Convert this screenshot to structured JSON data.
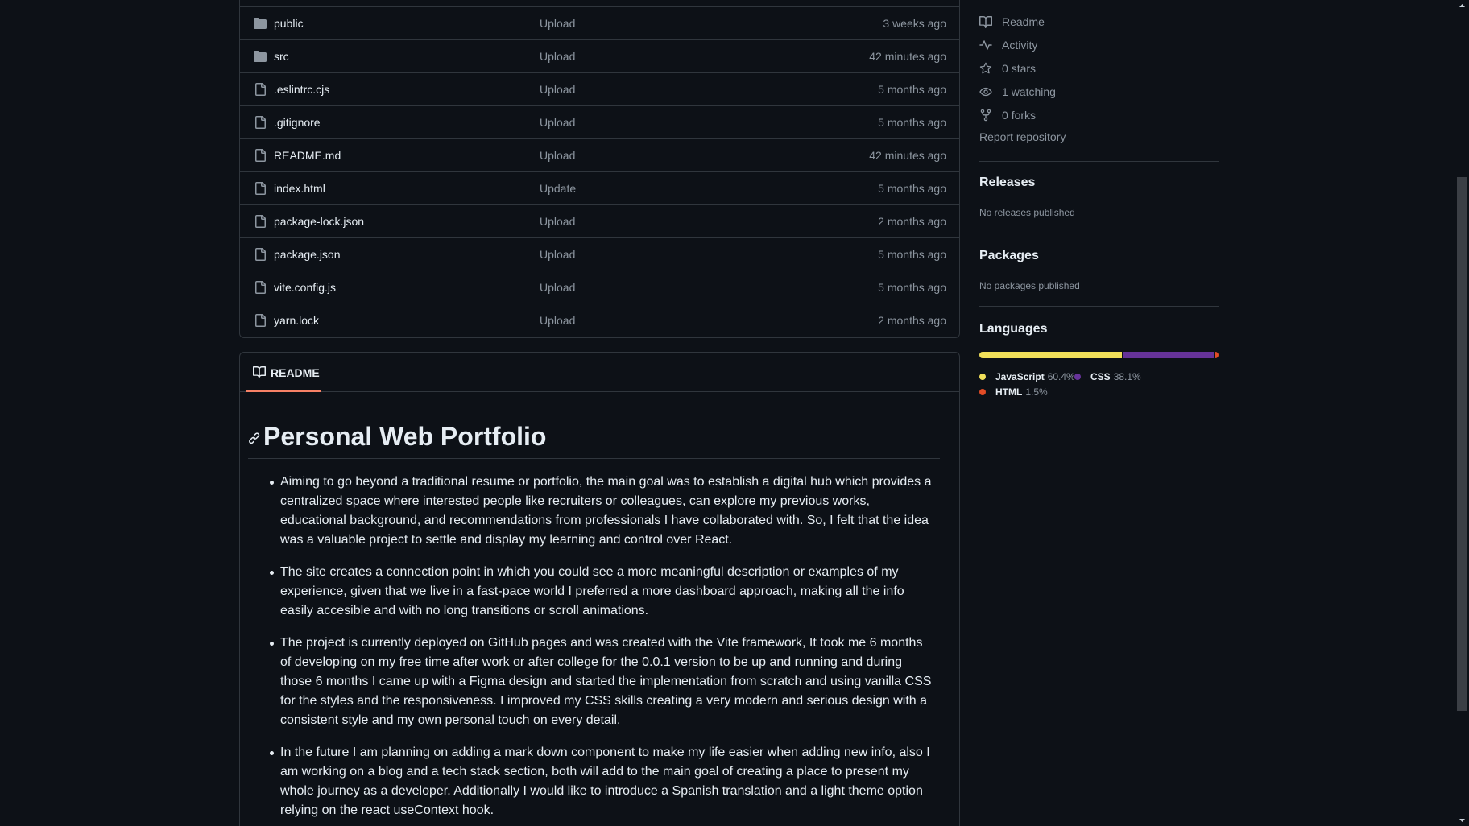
{
  "files": [
    {
      "name": "public",
      "type": "folder",
      "commit": "Upload",
      "date": "3 weeks ago"
    },
    {
      "name": "src",
      "type": "folder",
      "commit": "Upload",
      "date": "42 minutes ago"
    },
    {
      "name": ".eslintrc.cjs",
      "type": "file",
      "commit": "Upload",
      "date": "5 months ago"
    },
    {
      "name": ".gitignore",
      "type": "file",
      "commit": "Upload",
      "date": "5 months ago"
    },
    {
      "name": "README.md",
      "type": "file",
      "commit": "Upload",
      "date": "42 minutes ago"
    },
    {
      "name": "index.html",
      "type": "file",
      "commit": "Update",
      "date": "5 months ago"
    },
    {
      "name": "package-lock.json",
      "type": "file",
      "commit": "Upload",
      "date": "2 months ago"
    },
    {
      "name": "package.json",
      "type": "file",
      "commit": "Upload",
      "date": "5 months ago"
    },
    {
      "name": "vite.config.js",
      "type": "file",
      "commit": "Upload",
      "date": "5 months ago"
    },
    {
      "name": "yarn.lock",
      "type": "file",
      "commit": "Upload",
      "date": "2 months ago"
    }
  ],
  "readme": {
    "tab_label": "README",
    "heading": "Personal Web Portfolio",
    "bullets": [
      "Aiming to go beyond a traditional resume or portfolio, the main goal was to establish a digital hub which provides a centralized space where interested people like recruiters or colleagues, can explore my previous works, educational background, and recommendations from professionals I have collaborated with. So, I felt that the idea was a valuable project to settle and display my learning and control over React.",
      "The site creates a connection point in which you could see a more meaningful description or examples of my experience, given that we live in a fast-pace world I preferred a more dashboard approach, making all the info easily accesible and with no long transitions or scroll animations.",
      "The project is currently deployed on GitHub pages and was created with the Vite framework, It took me 6 months of developing on my free time after work or after college for the 0.0.1 version to be up and running and during those 6 months I came up with a Figma design and started the implementation from scratch and using vanilla CSS for the styles and the responsiveness. I improved my CSS skills creating a very modern and serious design with a consistent style and my own personal touch on every detail.",
      "In the future I am planning on adding a mark down component to make my life easier when adding new info, also I am working on a blog and a tech stack section, both will add to the main goal of creating a place to present my whole journey as a developer. Additionally I would like to introduce a Spanish translation and a light theme option relying on the react useContext hook."
    ]
  },
  "sidebar": {
    "readme": "Readme",
    "activity": "Activity",
    "stars_num": "0",
    "stars_label": "stars",
    "watching_num": "1",
    "watching_label": "watching",
    "forks_num": "0",
    "forks_label": "forks",
    "report": "Report repository",
    "releases_title": "Releases",
    "releases_note": "No releases published",
    "packages_title": "Packages",
    "packages_note": "No packages published",
    "languages_title": "Languages",
    "languages": [
      {
        "name": "JavaScript",
        "percent": "60.4%",
        "value": 60.4,
        "color": "#f1e05a"
      },
      {
        "name": "CSS",
        "percent": "38.1%",
        "value": 38.1,
        "color": "#663399"
      },
      {
        "name": "HTML",
        "percent": "1.5%",
        "value": 1.5,
        "color": "#e34c26"
      }
    ]
  },
  "colors": {
    "background": "#0d1117",
    "border": "#30363d",
    "text": "#e6edf3",
    "muted": "#8d96a0",
    "tab_accent": "#f78166"
  },
  "icons": {
    "folder": "folder-icon",
    "file": "file-icon",
    "book": "book-icon",
    "pulse": "pulse-icon",
    "star": "star-icon",
    "eye": "eye-icon",
    "fork": "fork-icon",
    "link": "link-icon"
  }
}
